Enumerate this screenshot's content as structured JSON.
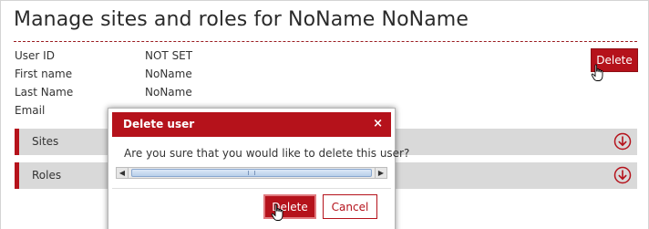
{
  "page": {
    "title": "Manage sites and roles for NoName NoName"
  },
  "user_info": [
    {
      "label": "User ID",
      "value": "NOT SET"
    },
    {
      "label": "First name",
      "value": "NoName"
    },
    {
      "label": "Last Name",
      "value": "NoName"
    },
    {
      "label": "Email",
      "value": ""
    }
  ],
  "actions": {
    "delete_label": "Delete"
  },
  "sections": [
    {
      "label": "Sites",
      "icon": "expand-down-icon"
    },
    {
      "label": "Roles",
      "icon": "expand-down-icon"
    }
  ],
  "dialog": {
    "title": "Delete user",
    "close_glyph": "×",
    "message": "Are you sure that you would like to delete this user?",
    "delete_label": "Delete",
    "cancel_label": "Cancel"
  },
  "colors": {
    "accent": "#b5121b",
    "section_bg": "#d9d9d9"
  }
}
